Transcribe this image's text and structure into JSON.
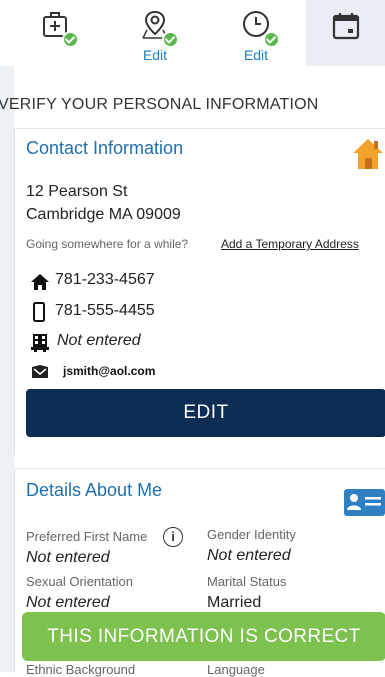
{
  "steps": [
    {
      "icon": "medical-kit-icon",
      "label": ""
    },
    {
      "icon": "location-pin-icon",
      "label": "Edit"
    },
    {
      "icon": "clock-icon",
      "label": "Edit"
    },
    {
      "icon": "calendar-icon",
      "label": ""
    }
  ],
  "page": {
    "heading": "VERIFY YOUR PERSONAL INFORMATION"
  },
  "contact": {
    "title": "Contact Information",
    "address_line1": "12 Pearson St",
    "address_line2": "Cambridge MA 09009",
    "temp_prompt": "Going somewhere for a while?",
    "temp_link": "Add a Temporary Address",
    "home_phone": "781-233-4567",
    "mobile_phone": "781-555-4455",
    "work_phone": "Not entered",
    "email": "jsmith@aol.com",
    "edit_label": "EDIT"
  },
  "details": {
    "title": "Details About Me",
    "preferred_name_label": "Preferred First Name",
    "preferred_name_value": "Not entered",
    "gender_label": "Gender Identity",
    "gender_value": "Not entered",
    "orientation_label": "Sexual Orientation",
    "orientation_value": "Not entered",
    "marital_label": "Marital Status",
    "marital_value": "Married",
    "ethnic_label": "Ethnic Background",
    "language_label": "Language"
  },
  "confirm": {
    "label": "THIS INFORMATION IS CORRECT"
  },
  "colors": {
    "primary": "#0d2d55",
    "link": "#1f6fae",
    "confirm": "#7dc14e",
    "check": "#59b94a"
  }
}
